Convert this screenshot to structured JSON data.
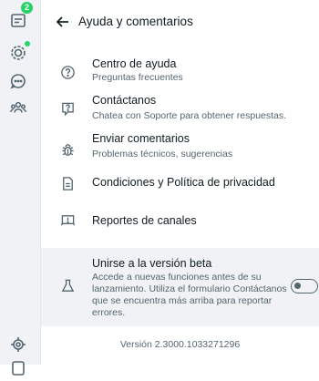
{
  "rail": {
    "chats_badge": "2",
    "status_dot_color": "#25d366",
    "icons": [
      "chats-icon",
      "status-icon",
      "channels-icon",
      "communities-icon",
      "settings-icon",
      "profile-icon"
    ]
  },
  "header": {
    "title": "Ayuda y comentarios"
  },
  "items": [
    {
      "icon": "help-circle-icon",
      "title": "Centro de ayuda",
      "subtitle": "Preguntas frecuentes"
    },
    {
      "icon": "contact-question-icon",
      "title": "Contáctanos",
      "subtitle": "Chatea con Soporte para obtener respuestas."
    },
    {
      "icon": "bug-icon",
      "title": "Enviar comentarios",
      "subtitle": "Problemas técnicos, sugerencias"
    },
    {
      "icon": "document-icon",
      "title": "Condiciones y Política de privacidad"
    },
    {
      "icon": "report-channel-icon",
      "title": "Reportes de canales"
    }
  ],
  "beta": {
    "icon": "flask-icon",
    "title": "Unirse a la versión beta",
    "description": "Accede a nuevas funciones antes de su lanzamiento. Utiliza el formulario Contáctanos que se encuentra más arriba para reportar errores.",
    "toggle_on": false
  },
  "version": "Versión 2.3000.1033271296"
}
